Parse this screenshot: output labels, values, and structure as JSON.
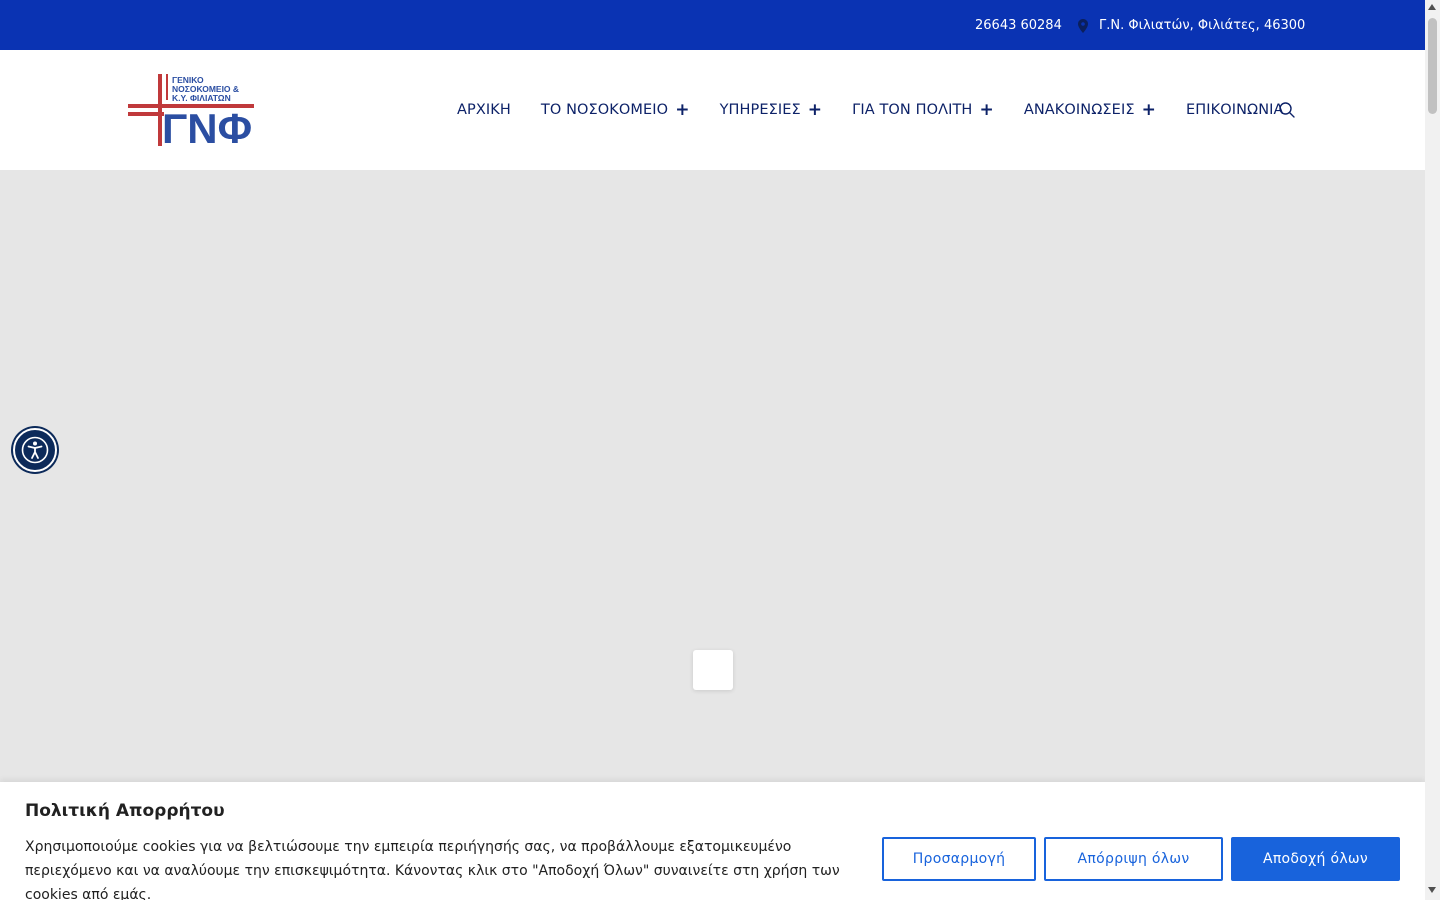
{
  "topbar": {
    "phone": "26643 60284",
    "address": "Γ.Ν. Φιλιατών, Φιλιάτες, 46300",
    "background": "#0a33b3"
  },
  "logo": {
    "line1": "ΓΕΝΙΚΟ",
    "line2": "ΝΟΣΟΚΟΜΕΙΟ &",
    "line3": "Κ.Υ. ΦΙΛΙΑΤΩΝ",
    "monogram": "ΓΝΦ",
    "cross_color": "#c0393b",
    "text_color": "#2b4ea2"
  },
  "nav": {
    "items": [
      {
        "label": "ΑΡΧΙΚΗ",
        "has_submenu": false
      },
      {
        "label": "ΤΟ ΝΟΣΟΚΟΜΕΙΟ",
        "has_submenu": true
      },
      {
        "label": "ΥΠΗΡΕΣΙΕΣ",
        "has_submenu": true
      },
      {
        "label": "ΓΙΑ ΤΟΝ ΠΟΛΙΤΗ",
        "has_submenu": true
      },
      {
        "label": "ΑΝΑΚΟΙΝΩΣΕΙΣ",
        "has_submenu": true
      },
      {
        "label": "ΕΠΙΚΟΙΝΩΝΙΑ",
        "has_submenu": false
      }
    ],
    "submenu_indicator": "+",
    "search_icon": "search-icon",
    "text_color": "#0d2268"
  },
  "cookie": {
    "title": "Πολιτική Απορρήτου",
    "text": "Χρησιμοποιούμε cookies για να βελτιώσουμε την εμπειρία περιήγησής σας, να προβάλλουμε εξατομικευμένο περιεχόμενο και να αναλύουμε την επισκεψιμότητα. Κάνοντας κλικ στο \"Αποδοχή Όλων\" συναινείτε στη χρήση των cookies από εμάς.",
    "customize_label": "Προσαρμογή",
    "reject_label": "Απόρριψη όλων",
    "accept_label": "Αποδοχή όλων",
    "accent": "#1863dc"
  },
  "accessibility_icon": "accessibility-icon"
}
